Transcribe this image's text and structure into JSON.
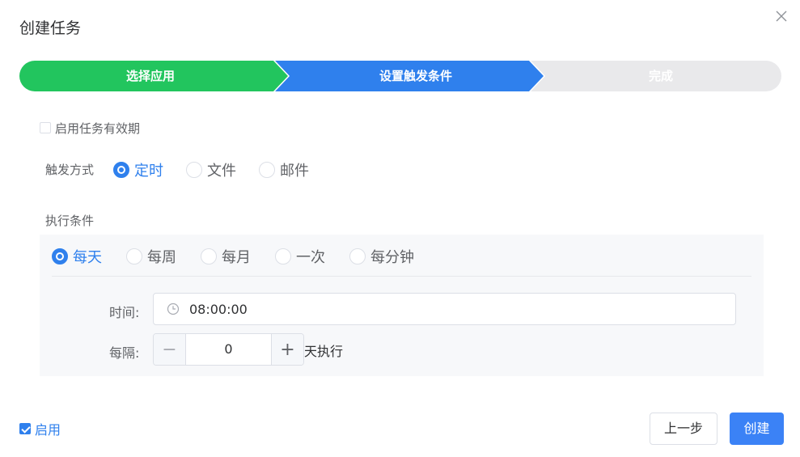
{
  "dialog": {
    "title": "创建任务",
    "close_icon": "close-icon"
  },
  "steps": [
    {
      "label": "选择应用",
      "status": "done",
      "color": "#22c55e"
    },
    {
      "label": "设置触发条件",
      "status": "active",
      "color": "#2f80ed"
    },
    {
      "label": "完成",
      "status": "pending",
      "color": "#e9e9eb"
    }
  ],
  "validity": {
    "label": "启用任务有效期",
    "checked": false
  },
  "trigger": {
    "label": "触发方式",
    "options": [
      "定时",
      "文件",
      "邮件"
    ],
    "selected": "定时"
  },
  "exec": {
    "label": "执行条件",
    "options": [
      "每天",
      "每周",
      "每月",
      "一次",
      "每分钟"
    ],
    "selected": "每天",
    "time_label": "时间:",
    "time_value": "08:00:00",
    "interval_label": "每隔:",
    "interval_value": "0",
    "interval_minus": "−",
    "interval_plus": "+",
    "interval_suffix": "天执行"
  },
  "footer": {
    "enable_label": "启用",
    "enable_checked": true,
    "prev_label": "上一步",
    "create_label": "创建"
  },
  "colors": {
    "accent": "#2f80ed",
    "success": "#22c55e",
    "pending": "#e9e9eb"
  }
}
